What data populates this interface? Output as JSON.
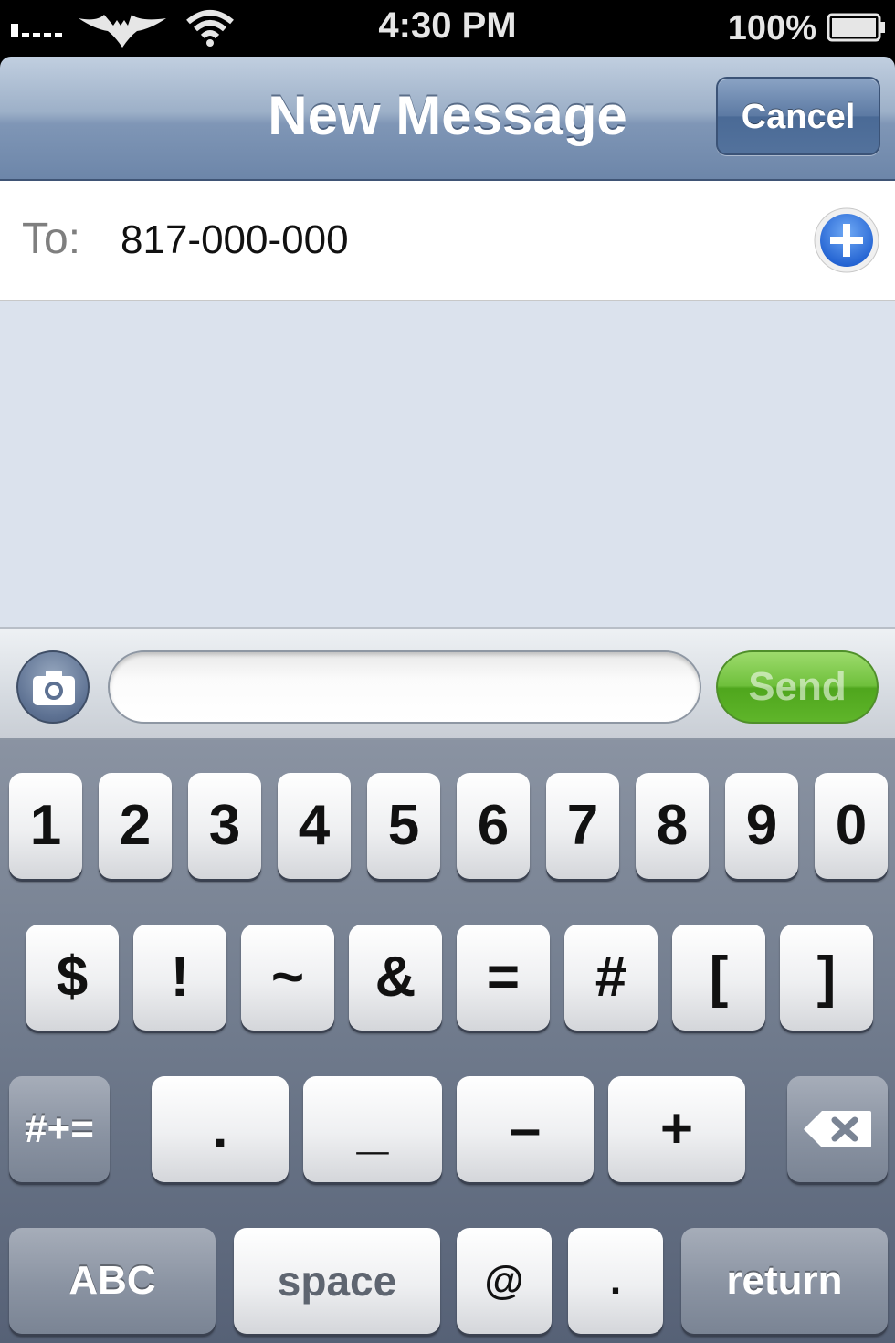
{
  "status_bar": {
    "time": "4:30 PM",
    "battery_percent": "100%",
    "icons": [
      "signal-icon",
      "carrier-logo-icon",
      "wifi-icon",
      "battery-icon"
    ]
  },
  "nav": {
    "title": "New Message",
    "cancel_label": "Cancel"
  },
  "to_field": {
    "label": "To:",
    "value": "817-000-000",
    "add_icon": "plus-circle-icon"
  },
  "compose": {
    "camera_icon": "camera-icon",
    "input_value": "",
    "send_label": "Send"
  },
  "keyboard": {
    "row1": [
      "1",
      "2",
      "3",
      "4",
      "5",
      "6",
      "7",
      "8",
      "9",
      "0"
    ],
    "row2": [
      "$",
      "!",
      "~",
      "&",
      "=",
      "#",
      "[",
      "]"
    ],
    "row3": {
      "shift_label": "#+=",
      "keys": [
        ".",
        "_",
        "–",
        "+"
      ],
      "delete_icon": "delete-icon"
    },
    "row4": {
      "abc_label": "ABC",
      "space_label": "space",
      "at_label": "@",
      "period_label": ".",
      "return_label": "return"
    }
  },
  "colors": {
    "nav_bar": "#8da2c0",
    "send_green": "#5fb52a",
    "conversation_bg": "#dbe2ed"
  }
}
